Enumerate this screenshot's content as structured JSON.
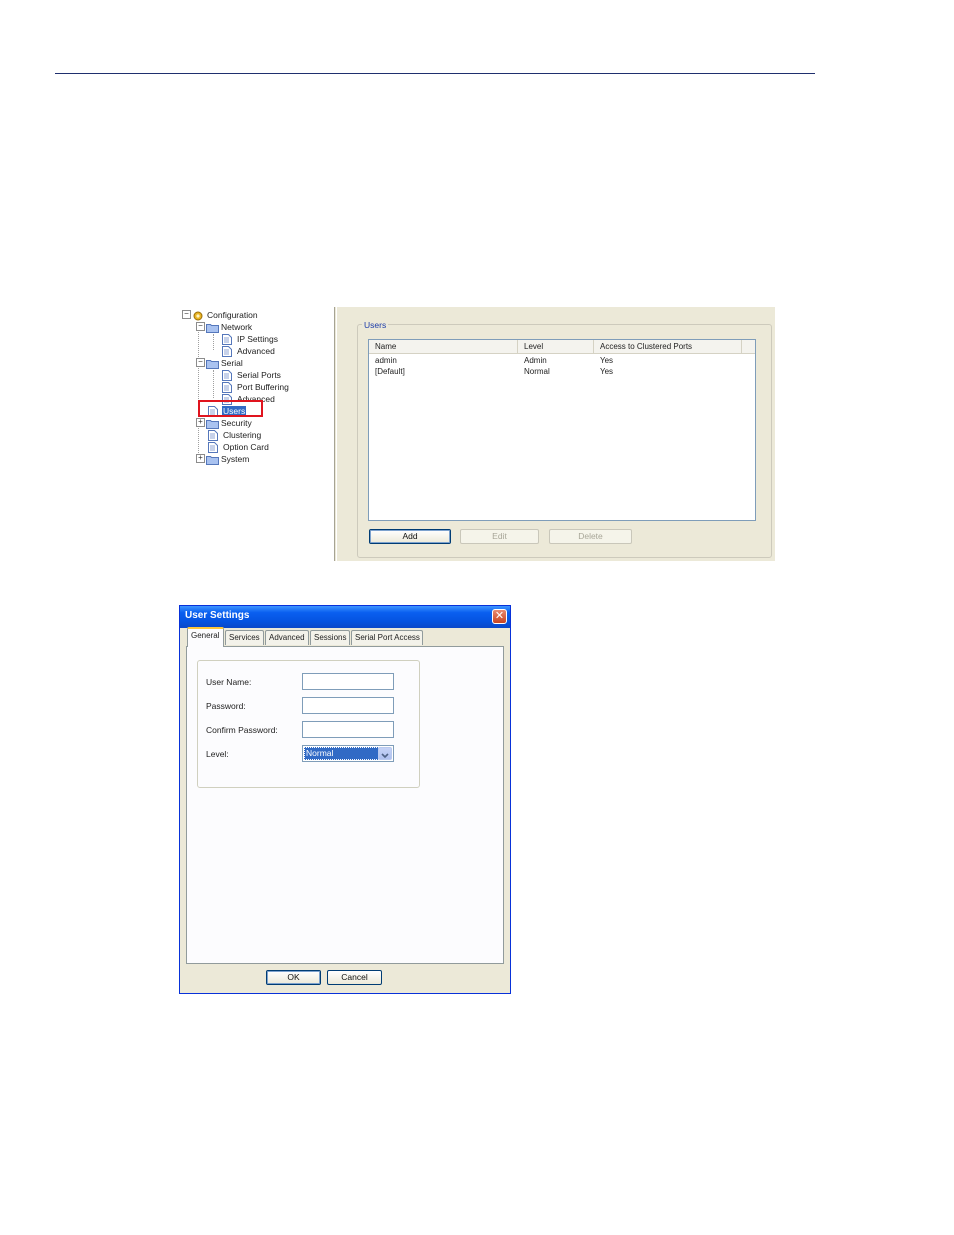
{
  "config_tree": {
    "items": [
      {
        "label": "Configuration",
        "icon": "configuration-icon"
      },
      {
        "label": "Network",
        "icon": "folder-icon"
      },
      {
        "label": "IP Settings",
        "icon": "page-icon"
      },
      {
        "label": "Advanced",
        "icon": "page-icon"
      },
      {
        "label": "Serial",
        "icon": "folder-icon"
      },
      {
        "label": "Serial Ports",
        "icon": "page-icon"
      },
      {
        "label": "Port Buffering",
        "icon": "page-icon"
      },
      {
        "label": "Advanced",
        "icon": "page-icon"
      },
      {
        "label": "Users",
        "icon": "page-icon",
        "selected": true
      },
      {
        "label": "Security",
        "icon": "folder-icon"
      },
      {
        "label": "Clustering",
        "icon": "page-icon"
      },
      {
        "label": "Option Card",
        "icon": "page-icon"
      },
      {
        "label": "System",
        "icon": "folder-icon"
      }
    ]
  },
  "users_panel": {
    "group_title": "Users",
    "columns": [
      "Name",
      "Level",
      "Access to Clustered Ports"
    ],
    "rows": [
      [
        "admin",
        "Admin",
        "Yes"
      ],
      [
        "[Default]",
        "Normal",
        "Yes"
      ]
    ],
    "add_label": "Add",
    "edit_label": "Edit",
    "delete_label": "Delete"
  },
  "dialog": {
    "title": "User Settings",
    "tabs": [
      "General",
      "Services",
      "Advanced",
      "Sessions",
      "Serial Port Access"
    ],
    "active_tab": "General",
    "fields": {
      "user_name_label": "User Name:",
      "user_name_value": "",
      "password_label": "Password:",
      "password_value": "",
      "confirm_password_label": "Confirm Password:",
      "confirm_password_value": "",
      "level_label": "Level:",
      "level_value": "Normal"
    },
    "ok_label": "OK",
    "cancel_label": "Cancel"
  },
  "colors": {
    "rule": "#1f2f6e",
    "selection": "#316ac5",
    "highlight_box": "#e0141e",
    "titlebar": "#0553e0",
    "active_tab_accent": "#ffc83c"
  }
}
